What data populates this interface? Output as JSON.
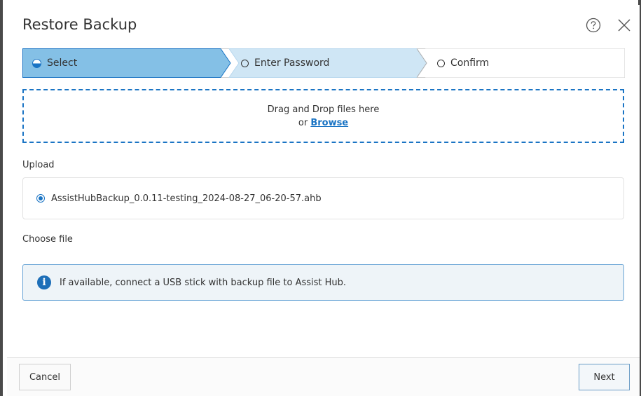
{
  "dialog": {
    "title": "Restore Backup",
    "help_icon": "help-circle-icon",
    "close_icon": "close-icon"
  },
  "stepper": {
    "steps": [
      {
        "label": "Select",
        "state": "active"
      },
      {
        "label": "Enter Password",
        "state": "upcoming"
      },
      {
        "label": "Confirm",
        "state": "upcoming"
      }
    ]
  },
  "dropzone": {
    "text": "Drag and Drop files here",
    "or_text": "or",
    "browse_label": "Browse"
  },
  "upload": {
    "label": "Upload",
    "file_name": "AssistHubBackup_0.0.11-testing_2024-08-27_06-20-57.ahb",
    "selected": true
  },
  "choose_file": {
    "label": "Choose file"
  },
  "info": {
    "icon": "info-icon",
    "message": "If available, connect a USB stick with backup file to Assist Hub."
  },
  "footer": {
    "cancel_label": "Cancel",
    "next_label": "Next"
  },
  "colors": {
    "accent": "#1a74c4",
    "step_active": "#84c0e6",
    "step_next": "#cfe6f5",
    "info_bg": "#eef4f8"
  }
}
